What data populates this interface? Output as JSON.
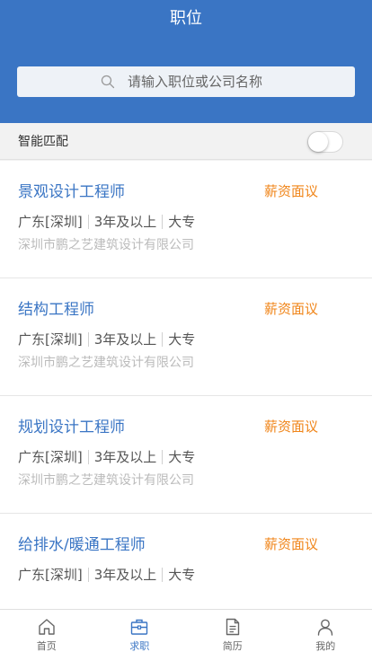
{
  "header": {
    "title": "职位"
  },
  "search": {
    "placeholder": "请输入职位或公司名称",
    "icon": "search-icon"
  },
  "match": {
    "label": "智能匹配",
    "enabled": false
  },
  "jobs": [
    {
      "title": "景观设计工程师",
      "salary": "薪资面议",
      "location": "广东[深圳]",
      "experience": "3年及以上",
      "education": "大专",
      "company": "深圳市鹏之艺建筑设计有限公司"
    },
    {
      "title": "结构工程师",
      "salary": "薪资面议",
      "location": "广东[深圳]",
      "experience": "3年及以上",
      "education": "大专",
      "company": "深圳市鹏之艺建筑设计有限公司"
    },
    {
      "title": "规划设计工程师",
      "salary": "薪资面议",
      "location": "广东[深圳]",
      "experience": "3年及以上",
      "education": "大专",
      "company": "深圳市鹏之艺建筑设计有限公司"
    },
    {
      "title": "给排水/暖通工程师",
      "salary": "薪资面议",
      "location": "广东[深圳]",
      "experience": "3年及以上",
      "education": "大专",
      "company": ""
    }
  ],
  "tabbar": {
    "items": [
      {
        "label": "首页",
        "icon": "home-icon",
        "active": false
      },
      {
        "label": "求职",
        "icon": "briefcase-icon",
        "active": true
      },
      {
        "label": "简历",
        "icon": "document-icon",
        "active": false
      },
      {
        "label": "我的",
        "icon": "user-icon",
        "active": false
      }
    ]
  },
  "colors": {
    "primary": "#3a75c4",
    "salary": "#f08519",
    "muted": "#bbbbbb"
  }
}
